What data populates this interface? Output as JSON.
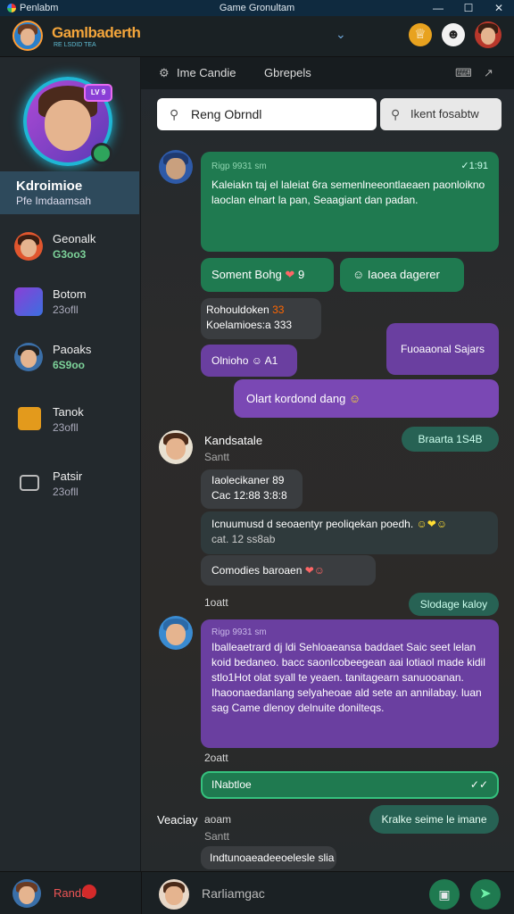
{
  "window": {
    "app_name": "Penlabm",
    "title": "Game Gronultam",
    "controls": [
      "—",
      "☐",
      "✕"
    ]
  },
  "header": {
    "brand": "Gamlbaderth",
    "brand_sub": "RE LSDID TEA",
    "mid_icon": "chevron-down-icon",
    "icons": [
      "crown-icon",
      "panda-icon",
      "user-avatar-icon"
    ]
  },
  "sidebar": {
    "level_badge": "LV 9",
    "me": {
      "name": "Kdroimioe",
      "sub": "Pfe Imdaamsah"
    },
    "items": [
      {
        "name": "Geonalk",
        "status": "G3oo3",
        "green": true
      },
      {
        "name": "Botom",
        "status": "23ofll",
        "green": false
      },
      {
        "name": "Paoaks",
        "status": "6S9oo",
        "green": true
      },
      {
        "name": "Tanok",
        "status": "23ofll",
        "green": false
      },
      {
        "name": "Patsir",
        "status": "23ofll",
        "green": false
      }
    ]
  },
  "tabs": {
    "first": "Ime Candie",
    "second": "Gbrepels"
  },
  "search": {
    "placeholder": "Reng Obrndl",
    "button": "Ikent fosabtw"
  },
  "messages": {
    "m1": {
      "header": "Rigp 9931 sm",
      "time": "✓1:91",
      "text": "Kaleiakn taj el laleiat 6ra semenlneeontlaeaen paonloikno laoclan elnart la pan, Seaagiant dan padan."
    },
    "r1": {
      "chip1": "Soment Bohg",
      "chip1_num": "9",
      "chip2": "Iaoea dagerer"
    },
    "g1": {
      "line1": "Rohouldoken",
      "line1_num": "33",
      "line2": "Koelamioes:a 333"
    },
    "p1": {
      "text": "Olnioho",
      "num": "A1",
      "right": "Fuoaaonal Sajars"
    },
    "p2": {
      "text": "Olart kordond dang"
    },
    "u2": {
      "name": "Kandsatale",
      "sub": "Santt",
      "chip": "Braarta",
      "chip_num": "1S4B"
    },
    "g2": {
      "line1": "Iaolecikaner",
      "line1_num": "89",
      "line2": "Cac 12:88 3:8:8"
    },
    "t1": {
      "text": "Icnuumusd d seoaentyr peoliqekan poedh.",
      "sub": "cat. 12 ss8ab"
    },
    "g3": {
      "text": "Comodies baroaen"
    },
    "mid": {
      "label": "1oatt",
      "chip": "Slodage kaloy"
    },
    "m2": {
      "header": "Rigp 9931 sm",
      "text": "Iballeaetrard dj ldi Sehloaeansa baddaet Saic seet lelan koid bedaneo. bacc saonlcobeegean aai lotiaol made kidil stlo1Hot olat syall te yeaen. tanitagearn sanuooanan. Ihaoonaedanlang selyaheoae ald sete an annilabay. luan sag Came dlenoy delnuite donilteqs."
    },
    "m2_after": {
      "label": "2oatt"
    },
    "g4": {
      "text": "INabtloe"
    },
    "u3": {
      "name": "Veaciay",
      "name2": "aoam",
      "sub": "Santt",
      "chip": "Kralke seime le imane"
    },
    "g5": {
      "text": "Indtunoaeadeeoelesle slia"
    }
  },
  "composer": {
    "me_label": "Randu",
    "placeholder": "Rarliamgac"
  }
}
